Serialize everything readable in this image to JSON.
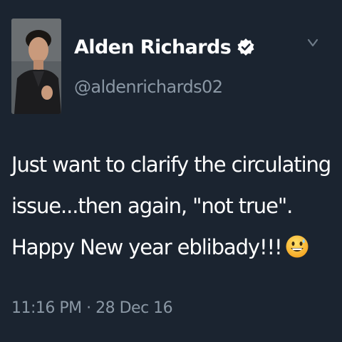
{
  "user": {
    "display_name": "Alden Richards",
    "handle": "@aldenrichards02",
    "verified": true
  },
  "tweet": {
    "text": "Just want to clarify the circulating issue...then again, \"not true\". Happy New year eblibady!!!",
    "emoji": "grinning-face-with-sweat-emoji",
    "timestamp": "11:16 PM · 28 Dec 16"
  },
  "icons": {
    "verified": "verified-badge-icon",
    "more": "chevron-down-icon"
  },
  "colors": {
    "background": "#1b2430",
    "primary_text": "#ffffff",
    "secondary_text": "#8b98a5"
  }
}
